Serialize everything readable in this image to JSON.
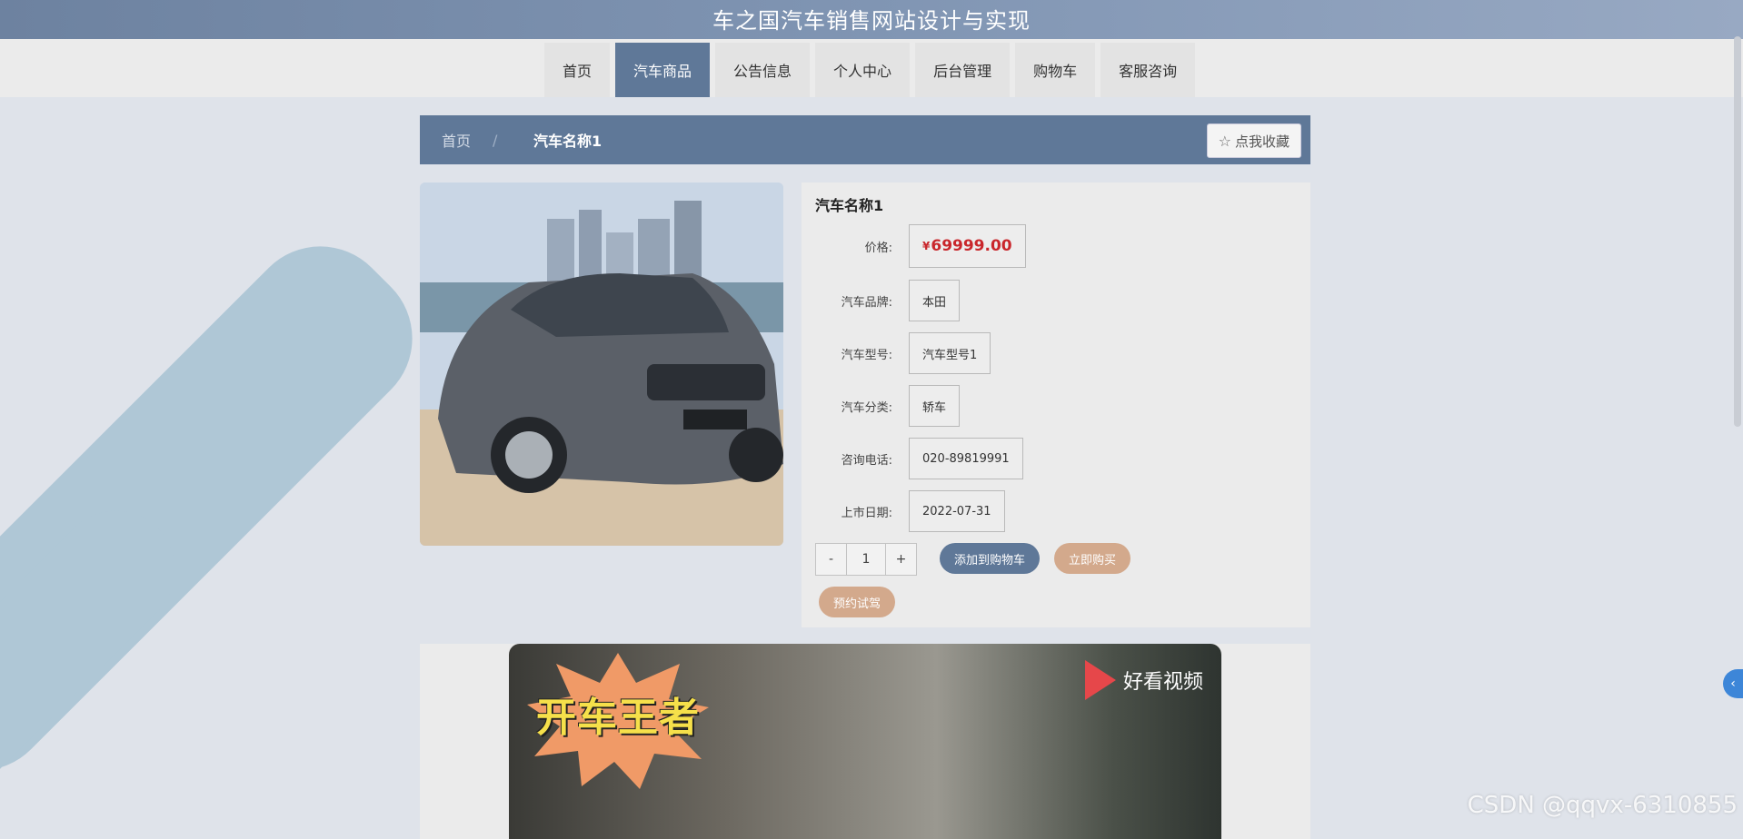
{
  "header": {
    "title": "车之国汽车销售网站设计与实现"
  },
  "nav": {
    "items": [
      "首页",
      "汽车商品",
      "公告信息",
      "个人中心",
      "后台管理",
      "购物车",
      "客服咨询"
    ],
    "active_index": 1
  },
  "breadcrumb": {
    "home": "首页",
    "separator": "/",
    "current": "汽车名称1"
  },
  "favorite_button": {
    "label": "点我收藏"
  },
  "product": {
    "name": "汽车名称1",
    "price_label": "价格:",
    "currency": "¥",
    "price": "69999.00",
    "attributes": [
      {
        "label": "汽车品牌:",
        "value": "本田"
      },
      {
        "label": "汽车型号:",
        "value": "汽车型号1"
      },
      {
        "label": "汽车分类:",
        "value": "轿车"
      },
      {
        "label": "咨询电话:",
        "value": "020-89819991"
      },
      {
        "label": "上市日期:",
        "value": "2022-07-31"
      }
    ]
  },
  "quantity": {
    "decrement": "-",
    "value": "1",
    "increment": "+"
  },
  "actions": {
    "add_to_cart": "添加到购物车",
    "buy_now": "立即购买",
    "test_drive": "预约试驾"
  },
  "video": {
    "caption": "开车王者",
    "brand": "好看视频"
  },
  "watermark": "CSDN @qqvx-6310855",
  "colors": {
    "primary": "#5f7898",
    "accent": "#d3a98c",
    "price": "#c9262b"
  }
}
